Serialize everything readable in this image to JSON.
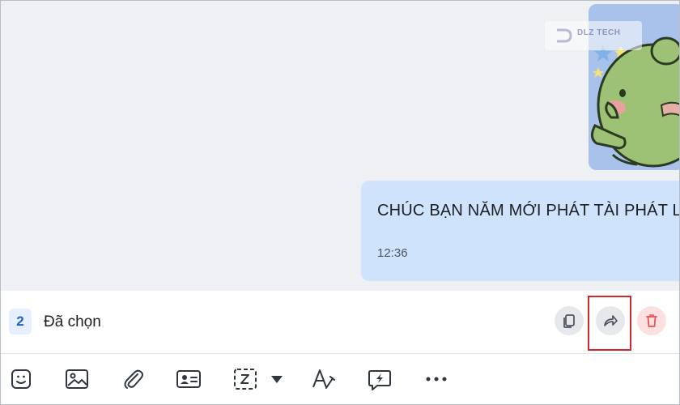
{
  "chat": {
    "message": {
      "text": "CHÚC BẠN NĂM MỚI PHÁT TÀI PHÁT LỘC",
      "time": "12:36"
    },
    "sticker_watermark": "DLZ TECH"
  },
  "selection_bar": {
    "count": "2",
    "label": "Đã chọn",
    "actions": [
      {
        "name": "copy",
        "icon": "copy-icon"
      },
      {
        "name": "forward",
        "icon": "forward-arrow-icon",
        "highlighted": true
      },
      {
        "name": "delete",
        "icon": "trash-icon"
      }
    ]
  },
  "composer_toolbar": {
    "tools": [
      "sticker-icon",
      "image-icon",
      "paperclip-icon",
      "contact-card-icon",
      "screenshot-icon",
      "chevron-down-icon",
      "text-format-icon",
      "quick-message-icon",
      "more-icon"
    ]
  },
  "colors": {
    "bubble": "#cfe3fd",
    "chat_background": "#eef0f3",
    "accent": "#1f5fd1",
    "highlight": "#d6252c",
    "delete": "#e25555"
  }
}
